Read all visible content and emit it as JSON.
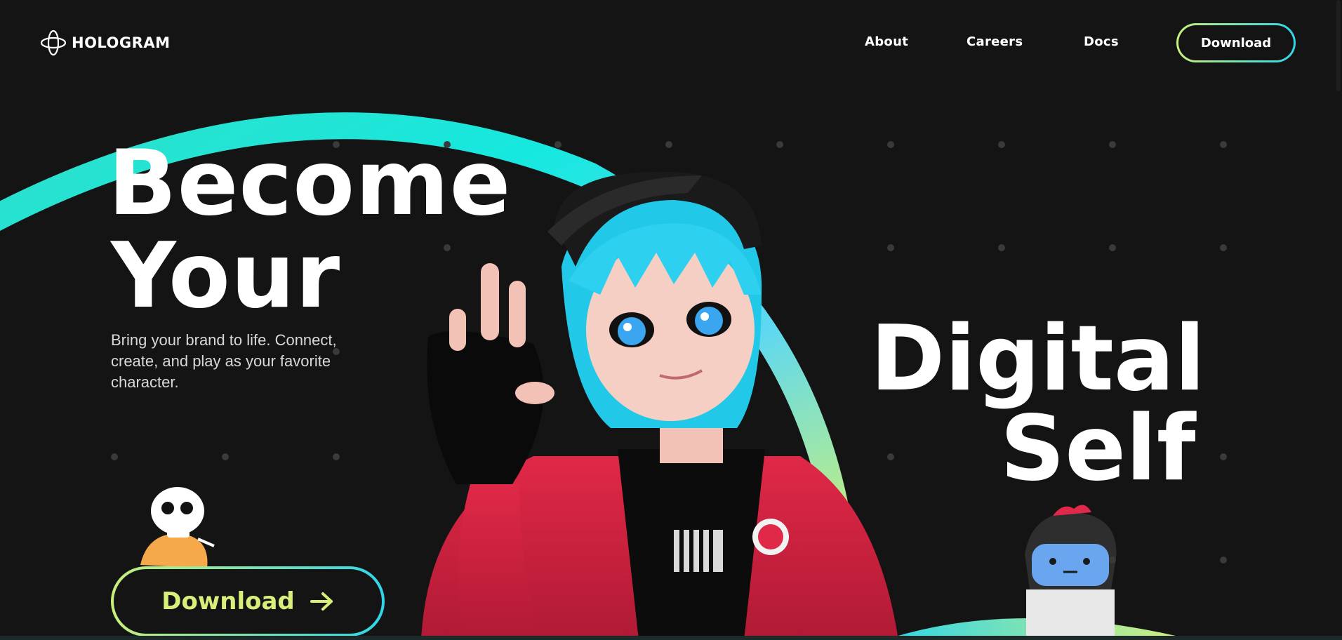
{
  "brand": {
    "name": "HOLOGRAM"
  },
  "nav": {
    "links": [
      {
        "label": "About"
      },
      {
        "label": "Careers"
      },
      {
        "label": "Docs"
      }
    ],
    "download_label": "Download"
  },
  "hero": {
    "heading_line1": "Become",
    "heading_line2": "Your",
    "heading_line3": "Digital",
    "heading_line4": "Self",
    "tagline": "Bring your brand to life. Connect, create, and play as your favorite character.",
    "cta_label": "Download",
    "cta_icon": "arrow-right-icon"
  },
  "colors": {
    "background": "#141414",
    "accent_green": "#c8f07a",
    "accent_cyan": "#2fd6e8",
    "cta_text": "#d8f07a"
  },
  "icons": [
    "hologram-logo-icon",
    "arrow-right-icon"
  ]
}
